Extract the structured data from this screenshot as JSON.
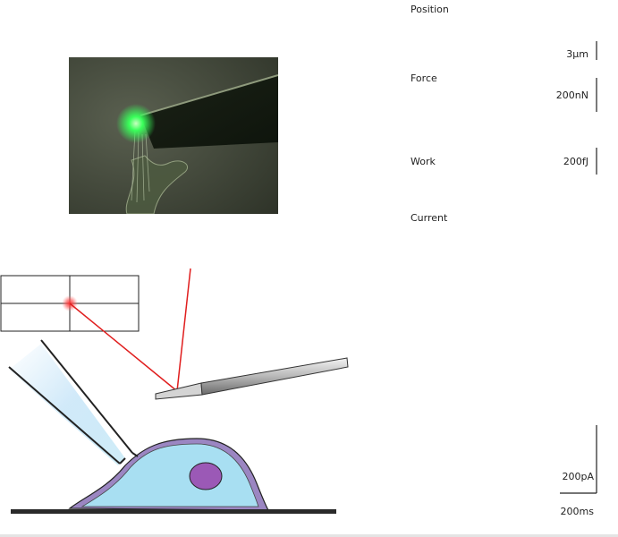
{
  "traces": {
    "position_label": "Position",
    "force_label": "Force",
    "work_label": "Work",
    "current_label": "Current"
  },
  "scale_bars": {
    "position": "3µm",
    "force": "200nN",
    "work": "200fJ",
    "current": "200pA",
    "time": "200ms"
  },
  "colors": {
    "laser": "#e01e1e",
    "cell_cytoplasm": "#a8dff2",
    "cell_membrane": "#9b86c2",
    "nucleus": "#9b59b6",
    "fluorescent_bead": "#39ff5a"
  }
}
